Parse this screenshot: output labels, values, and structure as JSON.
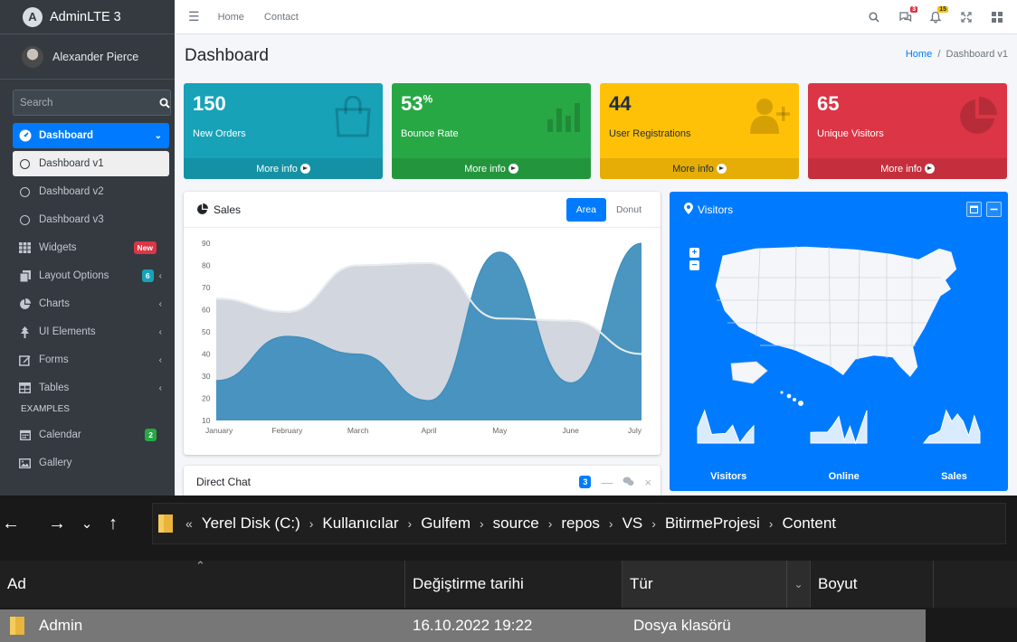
{
  "sidebar": {
    "brand": "AdminLTE 3",
    "user": "Alexander Pierce",
    "search_placeholder": "Search",
    "items": [
      {
        "label": "Dashboard"
      },
      {
        "label": "Dashboard v1"
      },
      {
        "label": "Dashboard v2"
      },
      {
        "label": "Dashboard v3"
      },
      {
        "label": "Widgets",
        "badge": "New"
      },
      {
        "label": "Layout Options",
        "badge": "6"
      },
      {
        "label": "Charts"
      },
      {
        "label": "UI Elements"
      },
      {
        "label": "Forms"
      },
      {
        "label": "Tables"
      }
    ],
    "section_header": "EXAMPLES",
    "examples": [
      {
        "label": "Calendar",
        "badge": "2"
      },
      {
        "label": "Gallery"
      }
    ]
  },
  "topnav": {
    "links": [
      "Home",
      "Contact"
    ],
    "messages_count": "3",
    "notifications_count": "15"
  },
  "page": {
    "title": "Dashboard",
    "breadcrumb": [
      "Home",
      "Dashboard v1"
    ]
  },
  "stats": [
    {
      "value": "150",
      "suffix": "",
      "label": "New Orders",
      "more": "More info",
      "color": "#17a2b8",
      "icon": "shopping-bag-icon"
    },
    {
      "value": "53",
      "suffix": "%",
      "label": "Bounce Rate",
      "more": "More info",
      "color": "#28a745",
      "icon": "bar-chart-icon"
    },
    {
      "value": "44",
      "suffix": "",
      "label": "User Registrations",
      "more": "More info",
      "color": "#ffc107",
      "icon": "user-plus-icon"
    },
    {
      "value": "65",
      "suffix": "",
      "label": "Unique Visitors",
      "more": "More info",
      "color": "#dc3545",
      "icon": "pie-chart-icon"
    }
  ],
  "sales": {
    "title": "Sales",
    "tabs": [
      "Area",
      "Donut"
    ],
    "active_tab": "Area"
  },
  "chart_data": {
    "type": "area",
    "categories": [
      "January",
      "February",
      "March",
      "April",
      "May",
      "June",
      "July"
    ],
    "series": [
      {
        "values": [
          65,
          59,
          80,
          81,
          56,
          55,
          40
        ],
        "color": "#d2d6de"
      },
      {
        "values": [
          28,
          48,
          40,
          19,
          86,
          27,
          90
        ],
        "color": "#3c8dbc"
      }
    ],
    "ylim": [
      10,
      90
    ],
    "yticks": [
      10,
      20,
      30,
      40,
      50,
      60,
      70,
      80,
      90
    ]
  },
  "visitors": {
    "title": "Visitors",
    "sparklines": [
      {
        "label": "Visitors",
        "values": [
          1000,
          1200,
          920,
          927,
          931,
          1027,
          819,
          930,
          1021
        ]
      },
      {
        "label": "Online",
        "values": [
          515,
          519,
          520,
          522,
          652,
          810,
          370,
          627,
          319,
          630,
          921
        ]
      },
      {
        "label": "Sales",
        "values": [
          15,
          19,
          20,
          22,
          33,
          27,
          31,
          27,
          19,
          30,
          21
        ]
      }
    ]
  },
  "chat": {
    "title": "Direct Chat",
    "badge": "3"
  },
  "explorer": {
    "path": [
      "Yerel Disk (C:)",
      "Kullanıcılar",
      "Gulfem",
      "source",
      "repos",
      "VS",
      "BitirmeProjesi",
      "Content"
    ],
    "path_prefix": "«",
    "columns": [
      "Ad",
      "Değiştirme tarihi",
      "Tür",
      "Boyut"
    ],
    "row": {
      "name": "Admin",
      "date": "16.10.2022 19:22",
      "type": "Dosya klasörü"
    }
  }
}
